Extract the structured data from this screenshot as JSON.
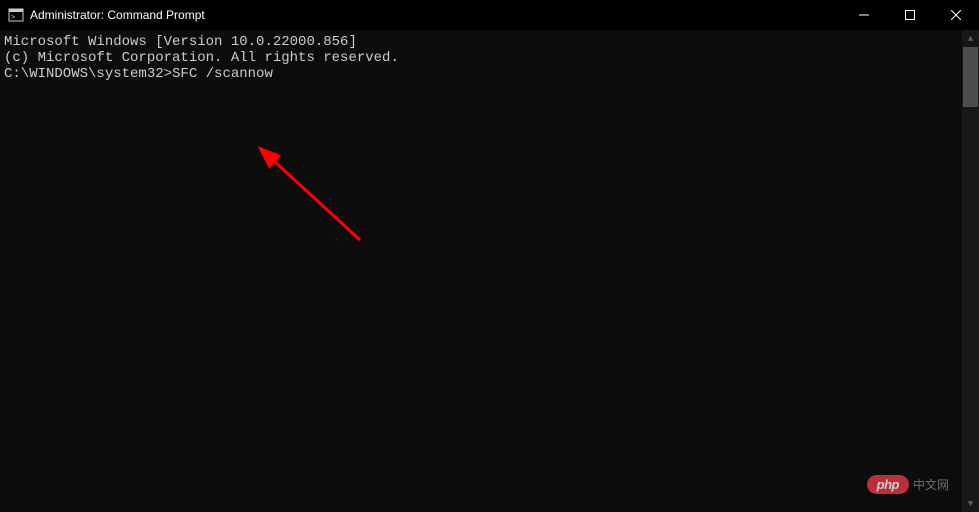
{
  "titlebar": {
    "title": "Administrator: Command Prompt"
  },
  "terminal": {
    "line1": "Microsoft Windows [Version 10.0.22000.856]",
    "line2": "(c) Microsoft Corporation. All rights reserved.",
    "blank": "",
    "prompt": "C:\\WINDOWS\\system32>",
    "command": "SFC /scannow"
  },
  "watermark": {
    "badge": "php",
    "text": "中文网"
  }
}
